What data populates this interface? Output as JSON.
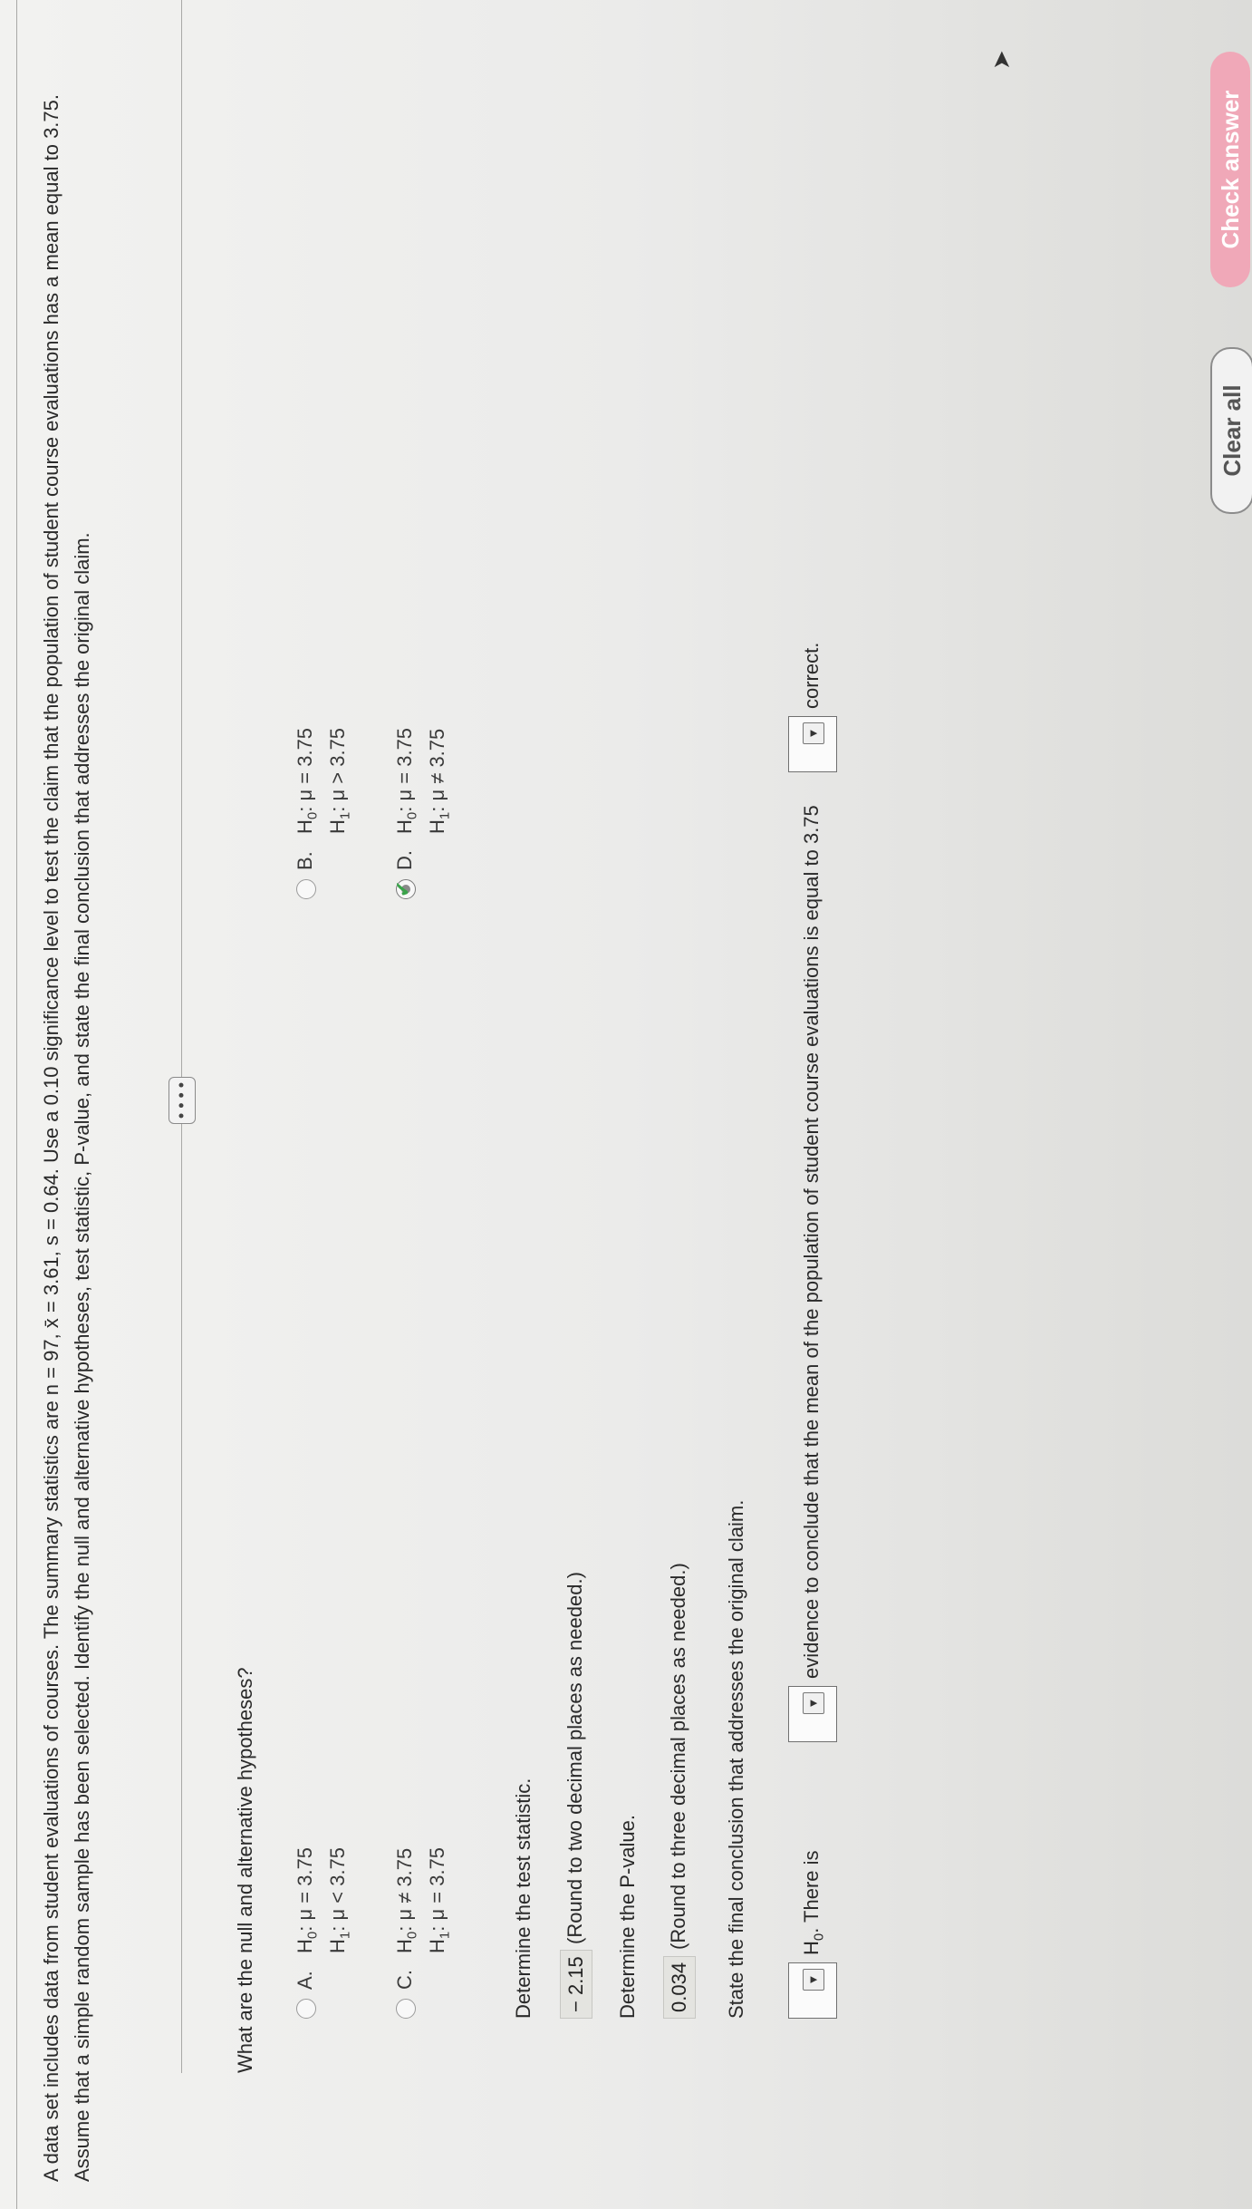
{
  "question": {
    "text": "A data set includes data from student evaluations of courses. The summary statistics are n = 97, x̄ = 3.61, s = 0.64. Use a 0.10 significance level to test the claim that the population of student course evaluations has a mean equal to 3.75. Assume that a simple random sample has been selected. Identify the null and alternative hypotheses, test statistic, P-value, and state the final conclusion that addresses the original claim."
  },
  "more_button": {
    "label": "• • • •"
  },
  "hypotheses": {
    "prompt": "What are the null and alternative hypotheses?",
    "options": [
      {
        "letter": "A.",
        "h0": "μ = 3.75",
        "h1": "μ < 3.75",
        "selected": false
      },
      {
        "letter": "B.",
        "h0": "μ = 3.75",
        "h1": "μ > 3.75",
        "selected": false
      },
      {
        "letter": "C.",
        "h0": "μ ≠ 3.75",
        "h1": "μ = 3.75",
        "selected": false
      },
      {
        "letter": "D.",
        "h0": "μ = 3.75",
        "h1": "μ ≠ 3.75",
        "selected": true
      }
    ],
    "h0_prefix": "H",
    "h1_prefix": "H",
    "h0_sub": "0",
    "h1_sub": "1"
  },
  "test_statistic": {
    "prompt": "Determine the test statistic.",
    "value": "− 2.15",
    "hint": "(Round to two decimal places as needed.)"
  },
  "p_value": {
    "prompt": "Determine the P-value.",
    "value": "0.034",
    "hint": "(Round to three decimal places as needed.)"
  },
  "conclusion": {
    "prompt": "State the final conclusion that addresses the original claim.",
    "h0_label": "H",
    "h0_sub": "0",
    "there_is": ". There is",
    "middle": "evidence to conclude that the mean of the population of student course evaluations is equal to 3.75",
    "end": "correct."
  },
  "buttons": {
    "clear_all": "Clear all",
    "check_answer": "Check answer"
  },
  "colors": {
    "check_answer_bg": "#f0a8b8",
    "correct_check": "#3aa44a"
  }
}
